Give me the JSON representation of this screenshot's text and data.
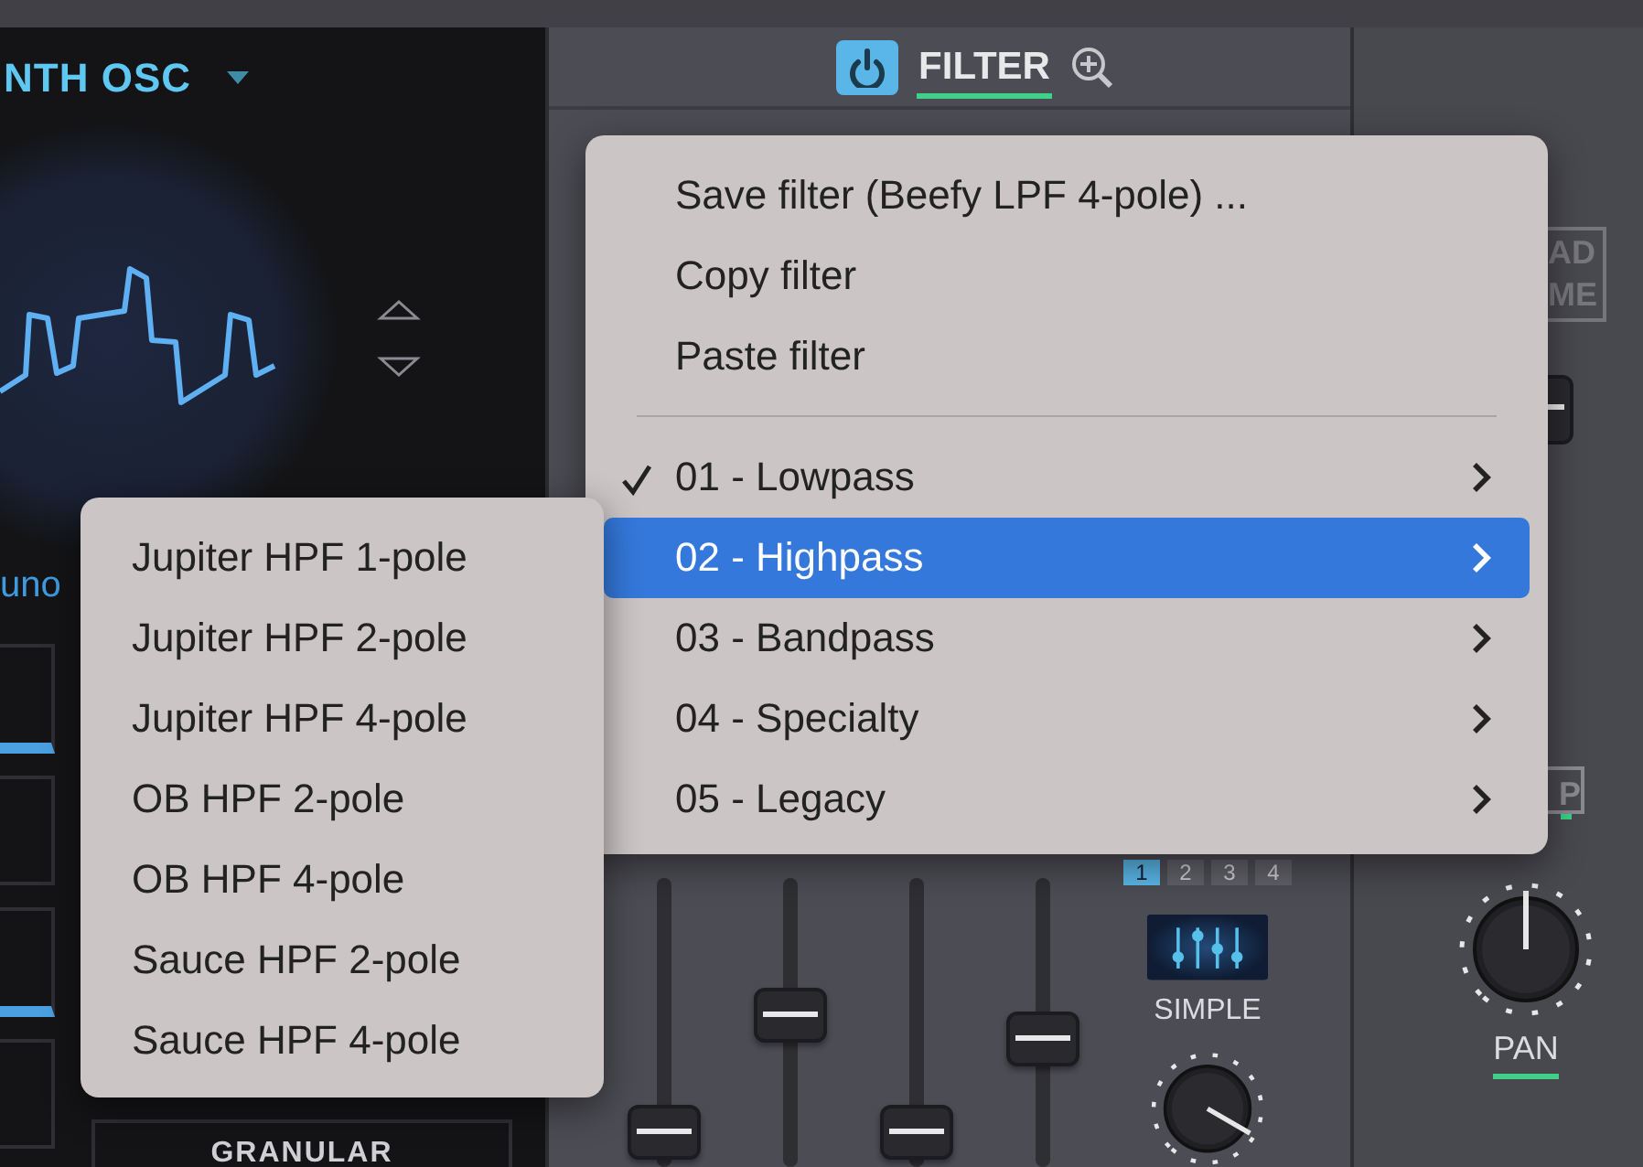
{
  "osc_panel": {
    "title": "NTH OSC",
    "subtitle": "uno",
    "button": "GRANULAR"
  },
  "filter_panel": {
    "power_on": true,
    "title": "FILTER",
    "voice_tabs": [
      {
        "label": "1",
        "selected": true
      },
      {
        "label": "2",
        "selected": false
      },
      {
        "label": "3",
        "selected": false
      },
      {
        "label": "4",
        "selected": false
      }
    ],
    "mode": "SIMPLE",
    "faders": [
      {
        "level": 0.05
      },
      {
        "level": 0.54
      },
      {
        "level": 0.05
      },
      {
        "level": 0.44
      }
    ]
  },
  "right_panel": {
    "box_lines": [
      "AD",
      "ME"
    ],
    "toggle": "P",
    "pan": {
      "label": "PAN"
    }
  },
  "filter_menu": {
    "actions": [
      "Save filter (Beefy LPF 4-pole) ...",
      "Copy filter",
      "Paste filter"
    ],
    "categories": [
      {
        "label": "01 - Lowpass",
        "checked": true,
        "selected": false,
        "submenu": true
      },
      {
        "label": "02 - Highpass",
        "checked": false,
        "selected": true,
        "submenu": true,
        "children": [
          "Jupiter HPF 1-pole",
          "Jupiter HPF 2-pole",
          "Jupiter HPF 4-pole",
          "OB HPF 2-pole",
          "OB HPF 4-pole",
          "Sauce HPF 2-pole",
          "Sauce HPF 4-pole"
        ]
      },
      {
        "label": "03 - Bandpass",
        "checked": false,
        "selected": false,
        "submenu": true
      },
      {
        "label": "04 - Specialty",
        "checked": false,
        "selected": false,
        "submenu": true
      },
      {
        "label": "05 - Legacy",
        "checked": false,
        "selected": false,
        "submenu": true
      }
    ]
  }
}
